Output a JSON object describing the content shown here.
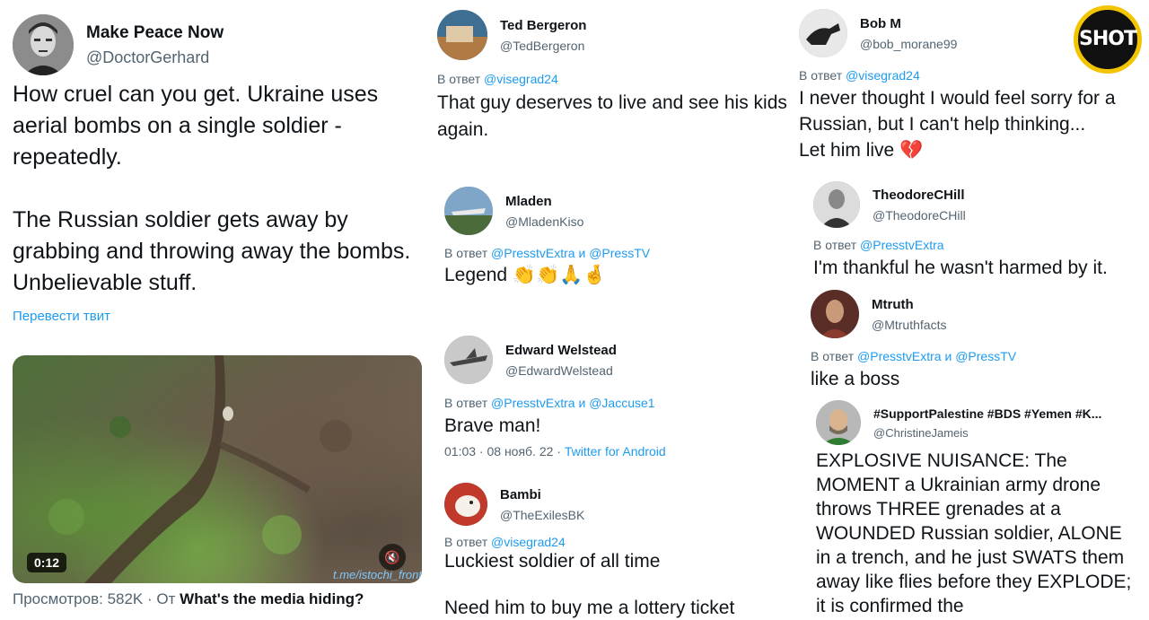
{
  "col1": {
    "name": "Make Peace Now",
    "handle": "@DoctorGerhard",
    "text": "How cruel can you get. Ukraine uses aerial bombs on a single soldier - repeatedly.\n\nThe Russian soldier gets away by grabbing and throwing away the bombs. Unbelievable stuff.",
    "translate": "Перевести твит",
    "video_time": "0:12",
    "watermark": "t.me/istochi_front",
    "views_label": "Просмотров: 582K",
    "views_from": "· От",
    "views_source": "What's the media hiding?"
  },
  "col2": [
    {
      "name": "Ted Bergeron",
      "handle": "@TedBergeron",
      "reply_prefix": "В ответ",
      "reply_to": "@visegrad24",
      "text": "That guy deserves to live and see his kids again."
    },
    {
      "name": "Mladen",
      "handle": "@MladenKiso",
      "reply_prefix": "В ответ",
      "reply_to": "@PresstvExtra и @PressTV",
      "text": "Legend"
    },
    {
      "name": "Edward Welstead",
      "handle": "@EdwardWelstead",
      "reply_prefix": "В ответ",
      "reply_to": "@PresstvExtra и @Jaccuse1",
      "text": "Brave man!",
      "meta_time": "01:03 · 08 нояб. 22 ·",
      "meta_source": "Twitter for Android"
    },
    {
      "name": "Bambi",
      "handle": "@TheExilesBK",
      "reply_prefix": "В ответ",
      "reply_to": "@visegrad24",
      "text": "Luckiest soldier of all time\n\nNeed him to buy me a lottery ticket"
    }
  ],
  "col3": [
    {
      "name": "Bob M",
      "handle": "@bob_morane99",
      "reply_prefix": "В ответ",
      "reply_to": "@visegrad24",
      "text": "I never thought I would feel sorry for a Russian, but I can't help thinking...\nLet him live"
    },
    {
      "name": "TheodoreCHill",
      "handle": "@TheodoreCHill",
      "reply_prefix": "В ответ",
      "reply_to": "@PresstvExtra",
      "text": "I'm thankful he wasn't harmed by it."
    },
    {
      "name": "Mtruth",
      "handle": "@Mtruthfacts",
      "reply_prefix": "В ответ",
      "reply_to": "@PresstvExtra и @PressTV",
      "text": "like a boss"
    },
    {
      "name": "#SupportPalestine #BDS #Yemen #K...",
      "handle": "@ChristineJameis",
      "text": "EXPLOSIVE NUISANCE: The MOMENT a Ukrainian army drone throws THREE grenades at a WOUNDED Russian soldier, ALONE in a trench, and he just SWATS them away like flies before they EXPLODE; it is confirmed the"
    }
  ],
  "logo": {
    "text": "SHOT",
    "ring_color": "#f3c400"
  },
  "colors": {
    "link": "#1d9bf0",
    "secondary_text": "#536471",
    "primary_text": "#0f1419"
  }
}
